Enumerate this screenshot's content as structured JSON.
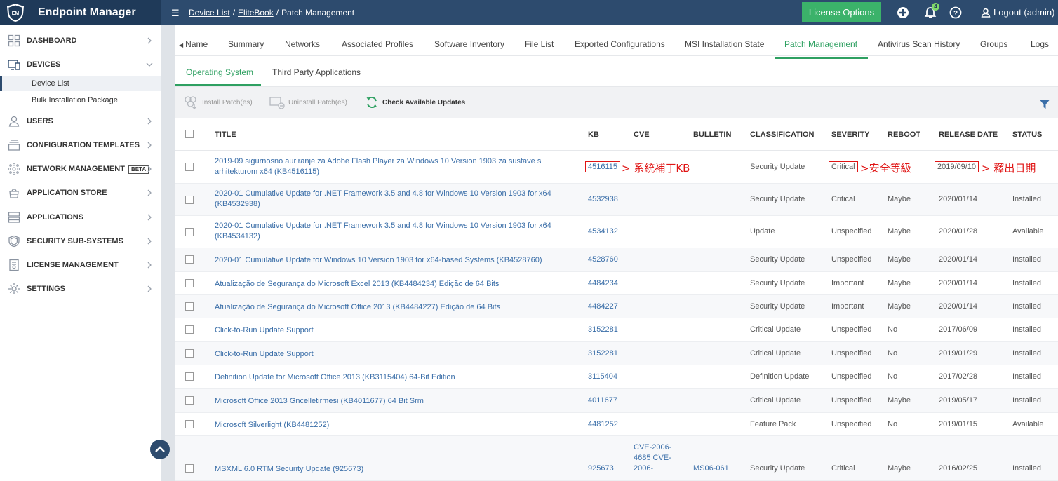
{
  "app": {
    "logo_text": "EM",
    "title": "Endpoint Manager"
  },
  "breadcrumb": {
    "items": [
      "Device List",
      "EliteBook",
      "Patch Management"
    ],
    "separator": "/"
  },
  "topbar": {
    "license_button": "License Options",
    "notification_count": "4",
    "logout_label": "Logout (admin)",
    "bg_color": "#2d4b6e",
    "accent_color": "#3bb26a"
  },
  "sidebar": {
    "items": [
      {
        "label": "DASHBOARD",
        "icon": "dashboard-grid-icon"
      },
      {
        "label": "DEVICES",
        "icon": "devices-icon",
        "expanded": true
      },
      {
        "label": "USERS",
        "icon": "user-icon"
      },
      {
        "label": "CONFIGURATION TEMPLATES",
        "icon": "templates-icon"
      },
      {
        "label": "NETWORK MANAGEMENT",
        "icon": "network-icon",
        "badge": "BETA"
      },
      {
        "label": "APPLICATION STORE",
        "icon": "store-icon"
      },
      {
        "label": "APPLICATIONS",
        "icon": "applications-icon"
      },
      {
        "label": "SECURITY SUB-SYSTEMS",
        "icon": "shield-icon"
      },
      {
        "label": "LICENSE MANAGEMENT",
        "icon": "license-icon"
      },
      {
        "label": "SETTINGS",
        "icon": "gear-icon"
      }
    ],
    "sub_items": [
      {
        "label": "Device List",
        "active": true
      },
      {
        "label": "Bulk Installation Package",
        "active": false
      }
    ]
  },
  "tabs": {
    "items": [
      "Name",
      "Summary",
      "Networks",
      "Associated Profiles",
      "Software Inventory",
      "File List",
      "Exported Configurations",
      "MSI Installation State",
      "Patch Management",
      "Antivirus Scan History",
      "Groups",
      "Logs"
    ],
    "active": "Patch Management"
  },
  "subtabs": {
    "items": [
      "Operating System",
      "Third Party Applications"
    ],
    "active": "Operating System"
  },
  "toolbar": {
    "install": "Install Patch(es)",
    "uninstall": "Uninstall Patch(es)",
    "check": "Check Available Updates"
  },
  "table": {
    "columns": [
      "TITLE",
      "KB",
      "CVE",
      "BULLETIN",
      "CLASSIFICATION",
      "SEVERITY",
      "REBOOT",
      "RELEASE DATE",
      "STATUS"
    ],
    "rows": [
      {
        "title": "2019-09 sigurnosno auriranje za Adobe Flash Player za Windows 10 Version 1903 za sustave s arhitekturom x64 (KB4516115)",
        "kb": "4516115",
        "cve": "",
        "bulletin": "",
        "classification": "Security Update",
        "severity": "Critical",
        "reboot": "",
        "release_date": "2019/09/10",
        "status": ""
      },
      {
        "title": "2020-01 Cumulative Update for .NET Framework 3.5 and 4.8 for Windows 10 Version 1903 for x64 (KB4532938)",
        "kb": "4532938",
        "cve": "",
        "bulletin": "",
        "classification": "Security Update",
        "severity": "Critical",
        "reboot": "Maybe",
        "release_date": "2020/01/14",
        "status": "Installed"
      },
      {
        "title": "2020-01 Cumulative Update for .NET Framework 3.5 and 4.8 for Windows 10 Version 1903 for x64 (KB4534132)",
        "kb": "4534132",
        "cve": "",
        "bulletin": "",
        "classification": "Update",
        "severity": "Unspecified",
        "reboot": "Maybe",
        "release_date": "2020/01/28",
        "status": "Available"
      },
      {
        "title": "2020-01 Cumulative Update for Windows 10 Version 1903 for x64-based Systems (KB4528760)",
        "kb": "4528760",
        "cve": "",
        "bulletin": "",
        "classification": "Security Update",
        "severity": "Unspecified",
        "reboot": "Maybe",
        "release_date": "2020/01/14",
        "status": "Installed"
      },
      {
        "title": "Atualização de Segurança do Microsoft Excel 2013 (KB4484234) Edição de 64 Bits",
        "kb": "4484234",
        "cve": "",
        "bulletin": "",
        "classification": "Security Update",
        "severity": "Important",
        "reboot": "Maybe",
        "release_date": "2020/01/14",
        "status": "Installed"
      },
      {
        "title": "Atualização de Segurança do Microsoft Office 2013 (KB4484227) Edição de 64 Bits",
        "kb": "4484227",
        "cve": "",
        "bulletin": "",
        "classification": "Security Update",
        "severity": "Important",
        "reboot": "Maybe",
        "release_date": "2020/01/14",
        "status": "Installed"
      },
      {
        "title": "Click-to-Run Update Support",
        "kb": "3152281",
        "cve": "",
        "bulletin": "",
        "classification": "Critical Update",
        "severity": "Unspecified",
        "reboot": "No",
        "release_date": "2017/06/09",
        "status": "Installed"
      },
      {
        "title": "Click-to-Run Update Support",
        "kb": "3152281",
        "cve": "",
        "bulletin": "",
        "classification": "Critical Update",
        "severity": "Unspecified",
        "reboot": "No",
        "release_date": "2019/01/29",
        "status": "Installed"
      },
      {
        "title": "Definition Update for Microsoft Office 2013 (KB3115404) 64-Bit Edition",
        "kb": "3115404",
        "cve": "",
        "bulletin": "",
        "classification": "Definition Update",
        "severity": "Unspecified",
        "reboot": "No",
        "release_date": "2017/02/28",
        "status": "Installed"
      },
      {
        "title": "Microsoft Office 2013 Gncelletirmesi (KB4011677) 64 Bit Srm",
        "kb": "4011677",
        "cve": "",
        "bulletin": "",
        "classification": "Critical Update",
        "severity": "Unspecified",
        "reboot": "Maybe",
        "release_date": "2019/05/17",
        "status": "Installed"
      },
      {
        "title": "Microsoft Silverlight (KB4481252)",
        "kb": "4481252",
        "cve": "",
        "bulletin": "",
        "classification": "Feature Pack",
        "severity": "Unspecified",
        "reboot": "No",
        "release_date": "2019/01/15",
        "status": "Available"
      },
      {
        "title": "MSXML 6.0 RTM Security Update (925673)",
        "kb": "925673",
        "cve": "CVE-2006-4685 CVE-2006-",
        "bulletin": "MS06-061",
        "classification": "Security Update",
        "severity": "Critical",
        "reboot": "Maybe",
        "release_date": "2016/02/25",
        "status": "Installed"
      }
    ]
  },
  "annotations": {
    "kb": "系統補丁KB",
    "severity": "安全等級",
    "release_date": "釋出日期",
    "color": "#e01414"
  }
}
